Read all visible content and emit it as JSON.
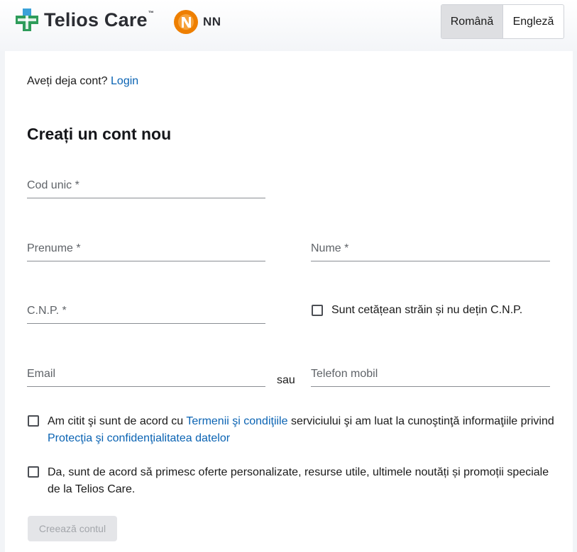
{
  "header": {
    "brand_name": "Telios Care",
    "brand_tm": "™",
    "partner_name": "NN",
    "languages": [
      {
        "label": "Română",
        "active": true
      },
      {
        "label": "Engleză",
        "active": false
      }
    ]
  },
  "login": {
    "prompt": "Aveți deja cont?",
    "link": "Login"
  },
  "form": {
    "title": "Creați un cont nou",
    "fields": {
      "cod_unic": {
        "placeholder": "Cod unic *",
        "value": ""
      },
      "prenume": {
        "placeholder": "Prenume *",
        "value": ""
      },
      "nume": {
        "placeholder": "Nume *",
        "value": ""
      },
      "cnp": {
        "placeholder": "C.N.P. *",
        "value": ""
      },
      "email": {
        "placeholder": "Email",
        "value": ""
      },
      "telefon": {
        "placeholder": "Telefon mobil",
        "value": ""
      }
    },
    "foreign_checkbox": "Sunt cetățean străin și nu dețin C.N.P.",
    "or_label": "sau",
    "terms": {
      "text_1": "Am citit şi sunt de acord cu ",
      "link_1": "Termenii şi condiţiile",
      "text_2": " serviciului şi am luat la cunoştinţă informaţiile privind ",
      "link_2": "Protecţia şi confidenţialitatea datelor"
    },
    "marketing": "Da, sunt de acord să primesc oferte personalizate, resurse utile, ultimele noutăți și promoții speciale de la Telios Care.",
    "submit_label": "Creează contul"
  },
  "colors": {
    "link": "#0a63b3",
    "brand_green": "#2e9c5a",
    "nn_orange": "#ee7f00",
    "button_disabled_bg": "#e4e5e8"
  }
}
